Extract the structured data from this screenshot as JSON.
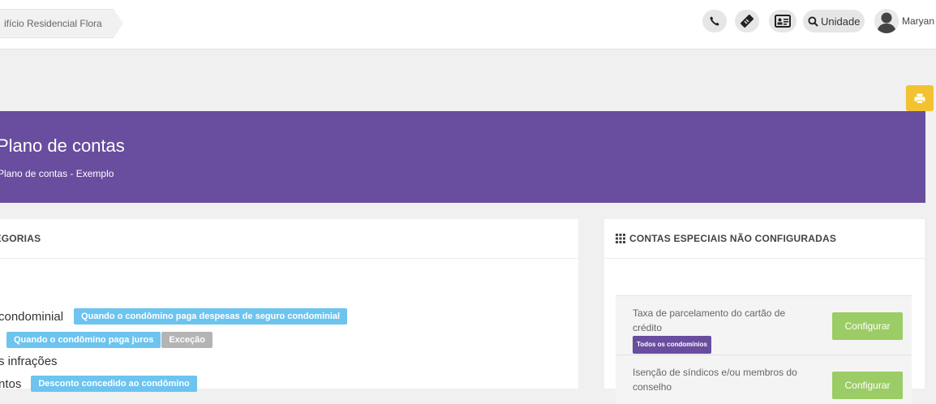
{
  "topbar": {
    "breadcrumb": "ifício Residencial Flora",
    "icons": [
      "phone-icon",
      "ticket-icon",
      "id-card-icon"
    ],
    "search_label": "Unidade",
    "user_name": "Maryan"
  },
  "banner": {
    "title": "Plano de contas",
    "subtitle": "Plano de contas - Exemplo",
    "color": "#694d9f"
  },
  "categories": {
    "header": "TEGORIAS",
    "rows": [
      {
        "label": "condominial",
        "badges": [
          {
            "text": "Quando o condômino paga despesas de seguro condominial"
          }
        ]
      },
      {
        "label": "",
        "badges": [
          {
            "text": "Quando o condômino paga juros"
          },
          {
            "text": "Exceção"
          }
        ]
      },
      {
        "label": "s infrações",
        "badges": []
      },
      {
        "label": "ntos",
        "badges": [
          {
            "text": "Desconto concedido ao condômino"
          }
        ]
      }
    ]
  },
  "special_accounts": {
    "header": "CONTAS ESPECIAIS NÃO CONFIGURADAS",
    "items": [
      {
        "text": "Taxa de parcelamento do cartão de crédito",
        "tag": "Todos os condomínios",
        "button": "Configurar"
      },
      {
        "text": "Isenção de síndicos e/ou membros do conselho",
        "tag": "",
        "button": "Configurar"
      }
    ]
  },
  "colors": {
    "accent": "#694d9f",
    "badge_blue": "#6cc4ef",
    "badge_gray": "#b4b4b4",
    "button_green": "#9ccc65",
    "print_yellow": "#f2c230"
  }
}
